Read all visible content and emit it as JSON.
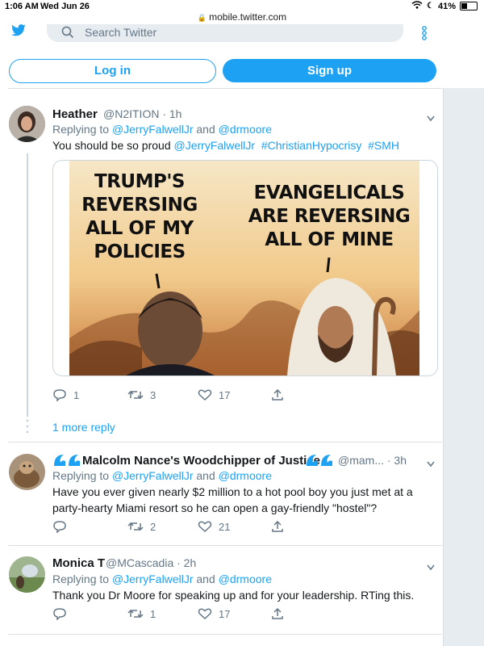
{
  "status_bar": {
    "time": "1:06 AM",
    "date": "Wed Jun 26",
    "battery": "41%",
    "battery_level": 0.41
  },
  "browser": {
    "url": "mobile.twitter.com"
  },
  "nav": {
    "search_placeholder": "Search Twitter"
  },
  "auth": {
    "login_label": "Log in",
    "signup_label": "Sign up"
  },
  "colors": {
    "accent": "#1da1f2",
    "muted": "#657786",
    "border": "#ccd6dd"
  },
  "tweets": [
    {
      "name": "Heather",
      "handle": "@N2ITION · 1h",
      "replying_prefix": "Replying to ",
      "replying_1": "@JerryFalwellJr",
      "replying_and": " and ",
      "replying_2": "@drmoore",
      "text_prefix": "You should be so proud ",
      "text_mention": "@JerryFalwellJr",
      "hashtag_1": "#ChristianHypocrisy",
      "hashtag_2": "#SMH",
      "image": {
        "left_text": "TRUMP'S REVERSING ALL OF MY POLICIES",
        "right_text": "EVANGELICALS ARE REVERSING ALL OF MINE"
      },
      "reply_count": "1",
      "retweet_count": "3",
      "like_count": "17"
    },
    {
      "name": "Malcolm Nance's Woodchipper of Justice",
      "handle": "@mam... · 3h",
      "replying_prefix": "Replying to ",
      "replying_1": "@JerryFalwellJr",
      "replying_and": " and ",
      "replying_2": "@drmoore",
      "text": "Have you ever given nearly $2 million to a hot pool boy you just met at a party-hearty Miami resort so he can open a gay-friendly \"hostel\"?",
      "reply_count": "",
      "retweet_count": "2",
      "like_count": "21"
    },
    {
      "name": "Monica T",
      "handle": "@MCascadia · 2h",
      "replying_prefix": "Replying to ",
      "replying_1": "@JerryFalwellJr",
      "replying_and": " and ",
      "replying_2": "@drmoore",
      "text": "Thank you Dr Moore for speaking up and for your leadership. RTing this.",
      "reply_count": "",
      "retweet_count": "1",
      "like_count": "17"
    }
  ],
  "more_replies": "1 more reply"
}
